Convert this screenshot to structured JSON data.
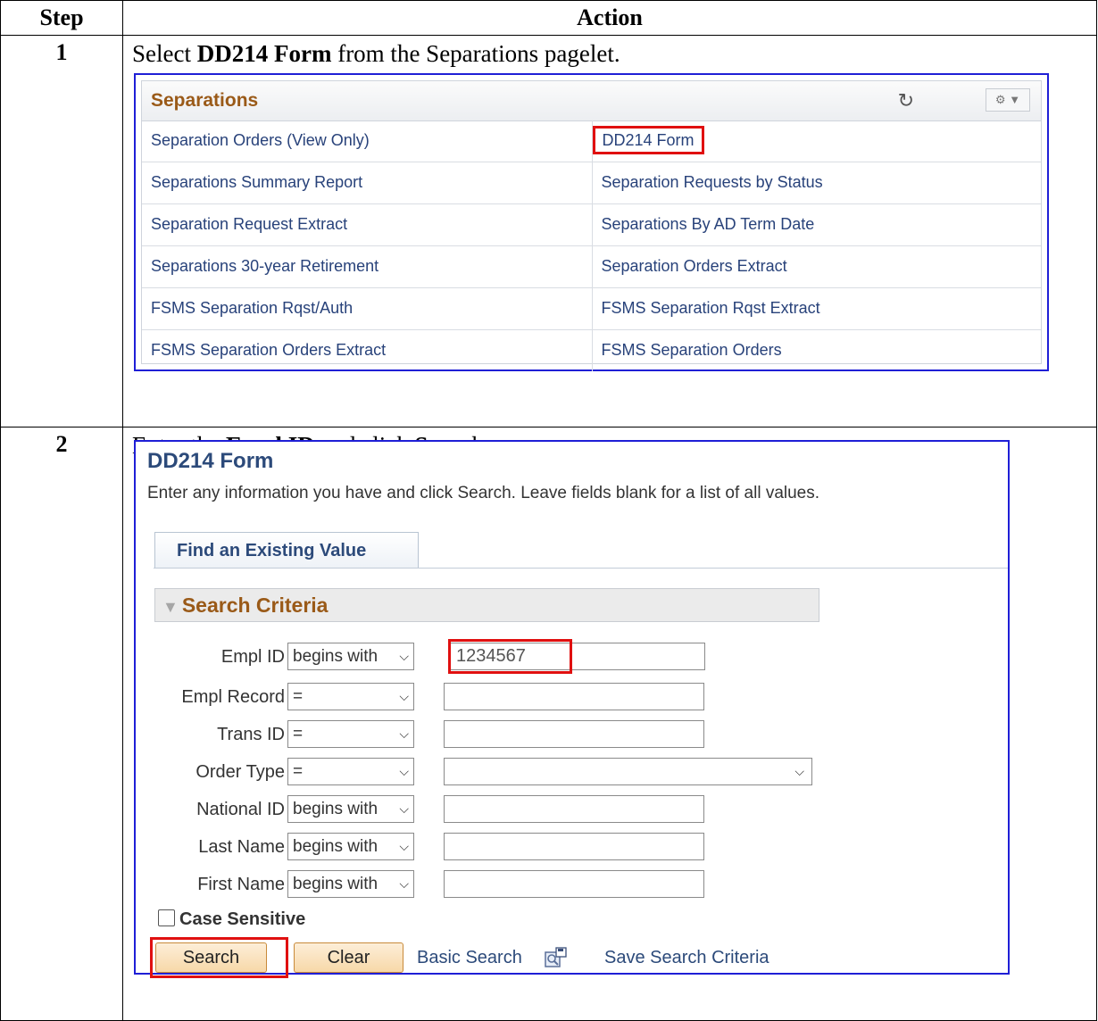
{
  "table": {
    "header_step": "Step",
    "header_action": "Action"
  },
  "steps": [
    {
      "number": "1",
      "text_before": "Select ",
      "text_bold": "DD214 Form",
      "text_after": " from the Separations pagelet."
    },
    {
      "number": "2",
      "text_before": "Enter the ",
      "text_bold": "Empl ID",
      "text_mid": " and click ",
      "text_bold2": "Searc",
      "text_after": "h."
    }
  ],
  "pagelet": {
    "title": "Separations",
    "refresh_icon": "refresh-icon",
    "gear_icon": "gear-icon",
    "links": [
      [
        "Separation Orders (View Only)",
        "DD214 Form"
      ],
      [
        "Separations Summary Report",
        "Separation Requests by Status"
      ],
      [
        "Separation Request Extract",
        "Separations By AD Term Date"
      ],
      [
        "Separations 30-year Retirement",
        "Separation Orders Extract"
      ],
      [
        "FSMS Separation Rqst/Auth",
        "FSMS Separation Rqst Extract"
      ],
      [
        "FSMS Separation Orders Extract",
        "FSMS Separation Orders"
      ]
    ]
  },
  "search_page": {
    "title": "DD214 Form",
    "instructions": "Enter any information you have and click Search. Leave fields blank for a list of all values.",
    "tab": "Find an Existing Value",
    "criteria_header": "Search Criteria",
    "fields": [
      {
        "label": "Empl ID",
        "operator": "begins with",
        "value": "1234567"
      },
      {
        "label": "Empl Record",
        "operator": "=",
        "value": ""
      },
      {
        "label": "Trans ID",
        "operator": "=",
        "value": ""
      },
      {
        "label": "Order Type",
        "operator": "=",
        "value": ""
      },
      {
        "label": "National ID",
        "operator": "begins with",
        "value": ""
      },
      {
        "label": "Last Name",
        "operator": "begins with",
        "value": ""
      },
      {
        "label": "First Name",
        "operator": "begins with",
        "value": ""
      }
    ],
    "case_sensitive_label": "Case Sensitive",
    "search_button": "Search",
    "clear_button": "Clear",
    "basic_search_link": "Basic Search",
    "save_search_link": "Save Search Criteria"
  },
  "colors": {
    "highlight": "#e01010",
    "frame": "#1f1fd6",
    "pagelet_title": "#9a5a18",
    "link": "#28427a"
  }
}
